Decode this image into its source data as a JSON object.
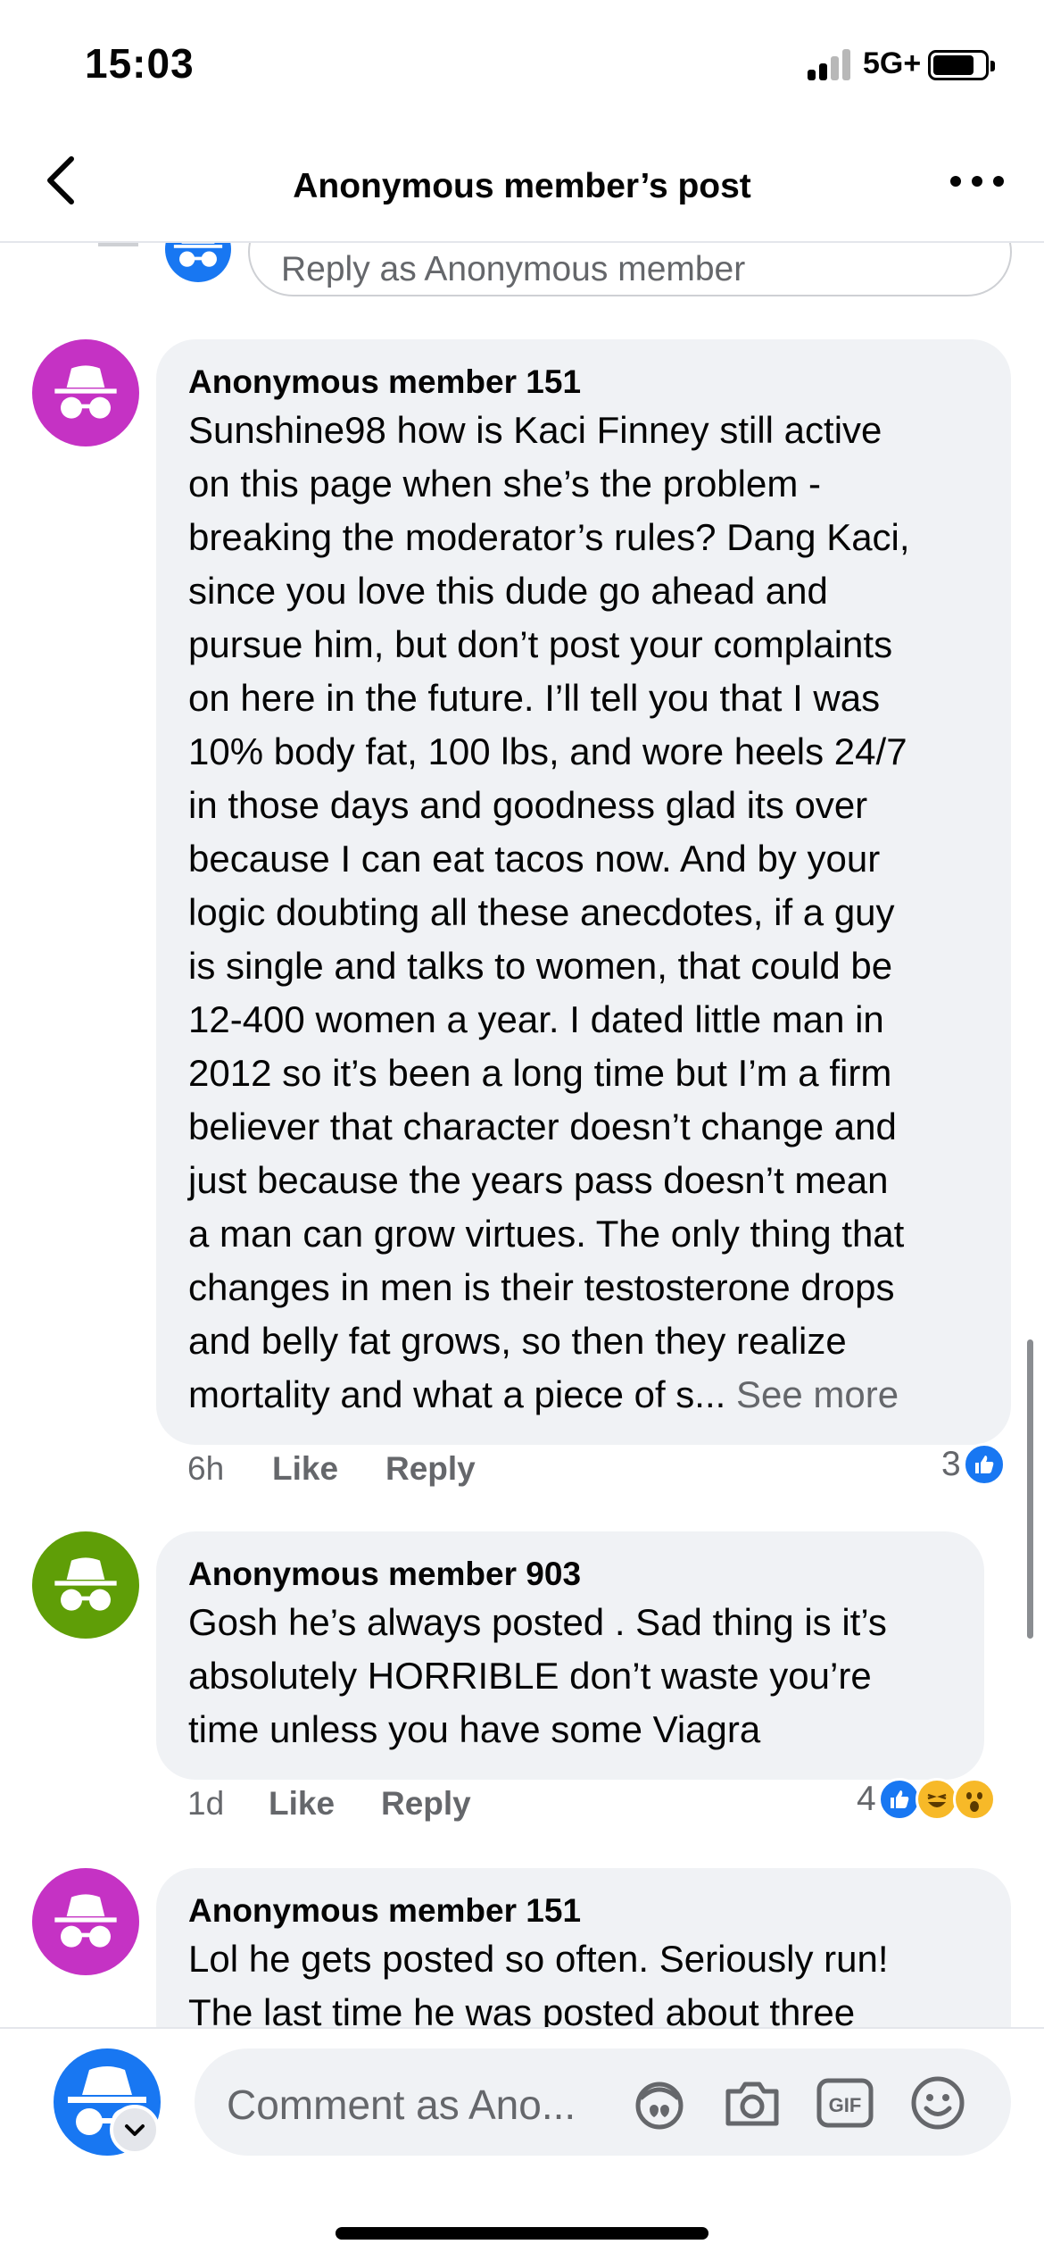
{
  "status_bar": {
    "time": "15:03",
    "network": "5G+"
  },
  "header": {
    "title": "Anonymous member’s post"
  },
  "reply_box": {
    "placeholder": "Reply as Anonymous member"
  },
  "colors": {
    "accent": "#1877f2",
    "avatar_magenta": "#c532c4",
    "avatar_green": "#5f9e07",
    "bubble": "#f0f2f5"
  },
  "comments": [
    {
      "author": "Anonymous member 151",
      "text": "Sunshine98 how is Kaci Finney still active\non this page when she’s the problem -\nbreaking the moderator’s rules? Dang Kaci,\nsince you love this dude go ahead and\npursue him, but don’t post your complaints\non here in the future. I’ll tell you that I was\n10% body fat, 100 lbs, and wore heels 24/7\nin those days and goodness glad its over\nbecause I can eat tacos now. And by your\nlogic doubting all these anecdotes, if a guy\nis single and talks to women, that could be\n12-400 women a year. I dated little man in\n2012 so it’s been a long time but I’m a firm\nbeliever that character doesn’t change and\njust because the years pass doesn’t mean\na man can grow virtues. The only thing that\nchanges in men is their testosterone drops\nand belly fat grows, so then they realize\nmortality and what a piece of s...",
      "see_more": " See more",
      "time": "6h",
      "like_label": "Like",
      "reply_label": "Reply",
      "reaction_count": "3",
      "reactions": [
        "like-icon"
      ]
    },
    {
      "author": "Anonymous member 903",
      "text": "Gosh he’s always posted . Sad thing is it’s\nabsolutely HORRIBLE don’t waste you’re\ntime unless you have some Viagra",
      "time": "1d",
      "like_label": "Like",
      "reply_label": "Reply",
      "reaction_count": "4",
      "reactions": [
        "like-icon",
        "haha-icon",
        "wow-icon"
      ]
    },
    {
      "author": "Anonymous member 151",
      "text": "Lol he gets posted so often. Seriously run!\nThe last time he was posted about three"
    }
  ],
  "composer": {
    "placeholder": "Comment as Ano...",
    "tools": [
      "avatar-sticker-icon",
      "camera-icon",
      "gif-icon",
      "emoji-icon"
    ]
  }
}
